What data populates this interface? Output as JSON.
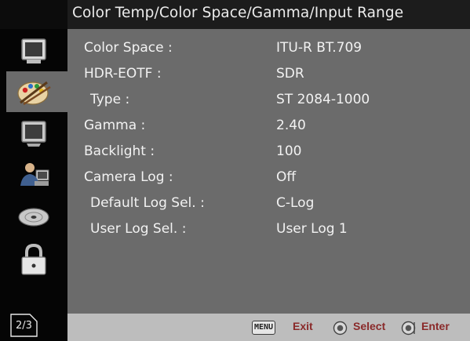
{
  "header": {
    "title": "Color Temp/Color Space/Gamma/Input Range"
  },
  "sidebar": {
    "items": [
      {
        "icon": "monitor-icon",
        "active": false
      },
      {
        "icon": "palette-icon",
        "active": true
      },
      {
        "icon": "display-icon",
        "active": false
      },
      {
        "icon": "user-settings-icon",
        "active": false
      },
      {
        "icon": "disc-icon",
        "active": false
      },
      {
        "icon": "lock-icon",
        "active": false
      }
    ],
    "page_indicator": "2/3"
  },
  "menu": {
    "rows": [
      {
        "label": "Color Space :",
        "value": "ITU-R BT.709"
      },
      {
        "label": "HDR-EOTF :",
        "value": "SDR"
      },
      {
        "label": "Type :",
        "value": "ST 2084-1000"
      },
      {
        "label": "Gamma :",
        "value": "2.40"
      },
      {
        "label": "Backlight :",
        "value": "100"
      },
      {
        "label": "Camera Log :",
        "value": "Off"
      },
      {
        "label": "Default Log Sel. :",
        "value": "C-Log"
      },
      {
        "label": "User Log Sel. :",
        "value": "User Log 1"
      }
    ]
  },
  "footer": {
    "menu_key": "MENU",
    "exit_label": "Exit",
    "select_label": "Select",
    "enter_label": "Enter"
  },
  "colors": {
    "content_bg": "#6b6b6b",
    "sidebar_bg": "#050505",
    "header_bg": "#1c1c1c",
    "footer_bg": "#bdbdbd",
    "footer_text": "#8a2a2a"
  }
}
